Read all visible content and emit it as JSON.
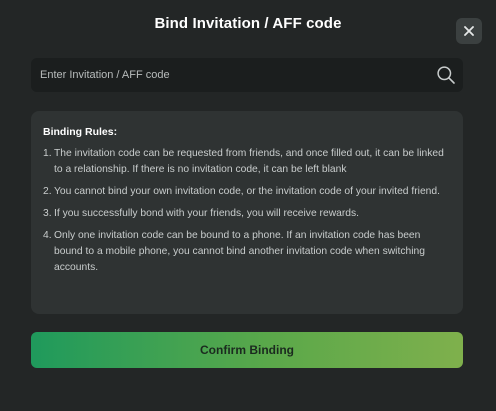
{
  "dialog": {
    "title": "Bind Invitation / AFF code",
    "close_icon": "close-icon"
  },
  "search": {
    "placeholder": "Enter Invitation / AFF code",
    "value": "",
    "icon": "search-icon"
  },
  "rules": {
    "title": "Binding Rules:",
    "items": [
      {
        "num": "1.",
        "text": "The invitation code can be requested from friends, and once filled out, it can be linked to a relationship. If there is no invitation code, it can be left blank"
      },
      {
        "num": "2.",
        "text": "You cannot bind your own invitation code, or the invitation code of your invited friend."
      },
      {
        "num": "3.",
        "text": "If you successfully bond with your friends, you will receive rewards."
      },
      {
        "num": "4.",
        "text": "Only one invitation code can be bound to a phone. If an invitation code has been bound to a mobile phone, you cannot bind another invitation code when switching accounts."
      }
    ]
  },
  "actions": {
    "confirm_label": "Confirm Binding"
  },
  "colors": {
    "background": "#232626",
    "panel": "#2f3333",
    "input": "#1b1e1e",
    "accent_start": "#1f9a5c",
    "accent_end": "#7fb04c"
  }
}
